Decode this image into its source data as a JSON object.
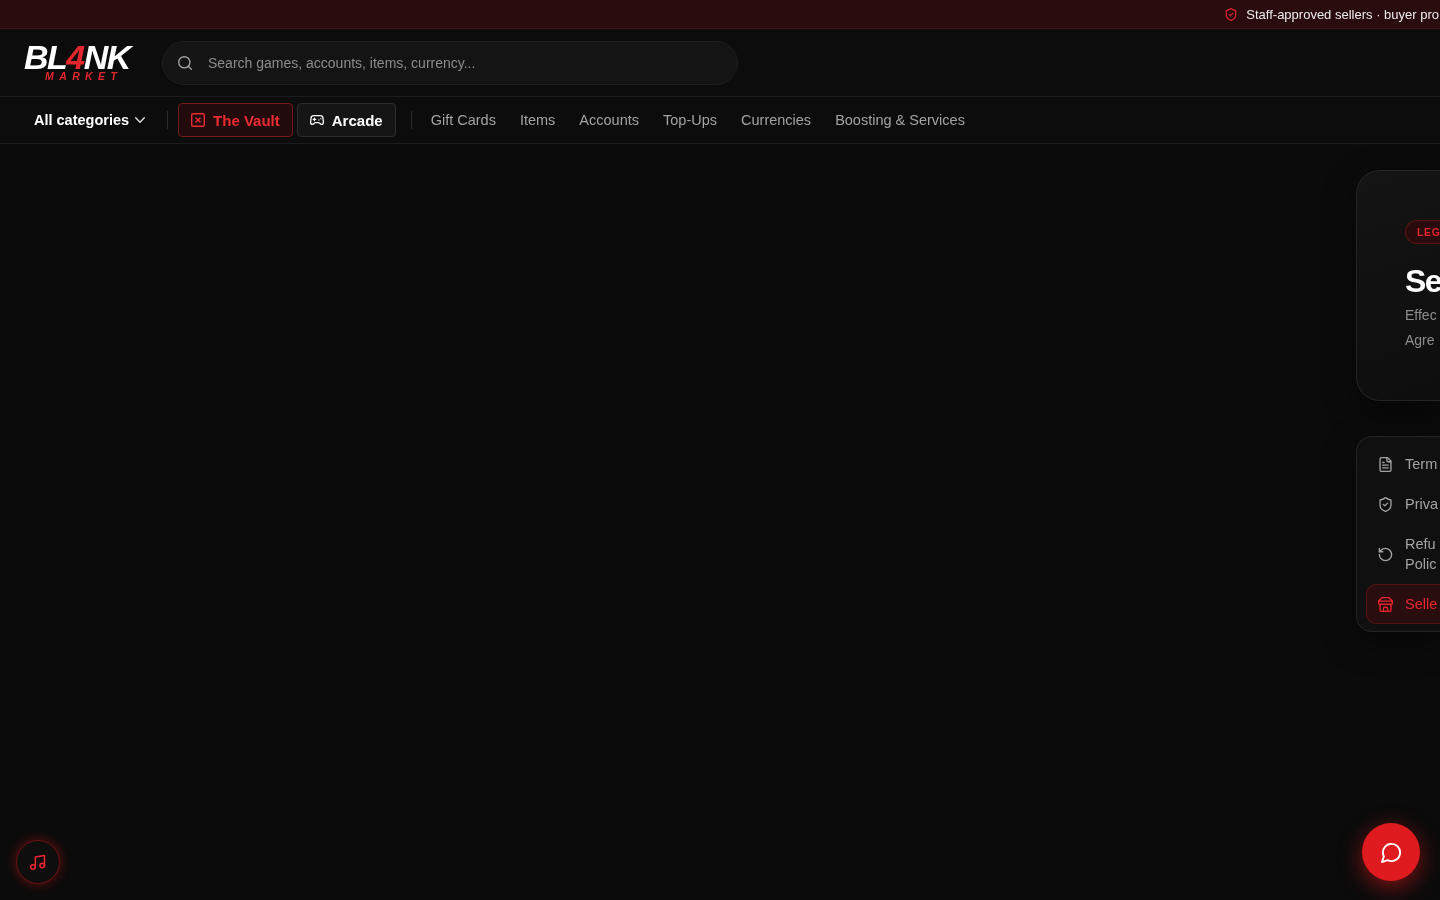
{
  "banner": {
    "text": "Staff-approved sellers · buyer pro"
  },
  "header": {
    "logo": {
      "parts": [
        {
          "text": "BL",
          "accent": false
        },
        {
          "text": "4",
          "accent": true
        },
        {
          "text": "NK",
          "accent": false
        }
      ],
      "tagline": "MARKET"
    },
    "search": {
      "placeholder": "Search games, accounts, items, currency..."
    }
  },
  "nav": {
    "categories": {
      "label": "All categories"
    },
    "featured": [
      {
        "label": "The Vault",
        "kind": "accent"
      },
      {
        "label": "Arcade",
        "kind": "plain"
      }
    ],
    "links": [
      "Gift Cards",
      "Items",
      "Accounts",
      "Top-Ups",
      "Currencies",
      "Boosting & Services"
    ]
  },
  "legal_card": {
    "badge": "LEG",
    "title": "Se",
    "description": "Effec Agre"
  },
  "legal_menu": {
    "items": [
      {
        "label": "Term",
        "kind": "terms",
        "selected": false
      },
      {
        "label": "Priva",
        "kind": "privacy",
        "selected": false
      },
      {
        "label": "Refu Polic",
        "kind": "refund",
        "selected": false
      },
      {
        "label": "Selle",
        "kind": "seller",
        "selected": true
      }
    ]
  }
}
